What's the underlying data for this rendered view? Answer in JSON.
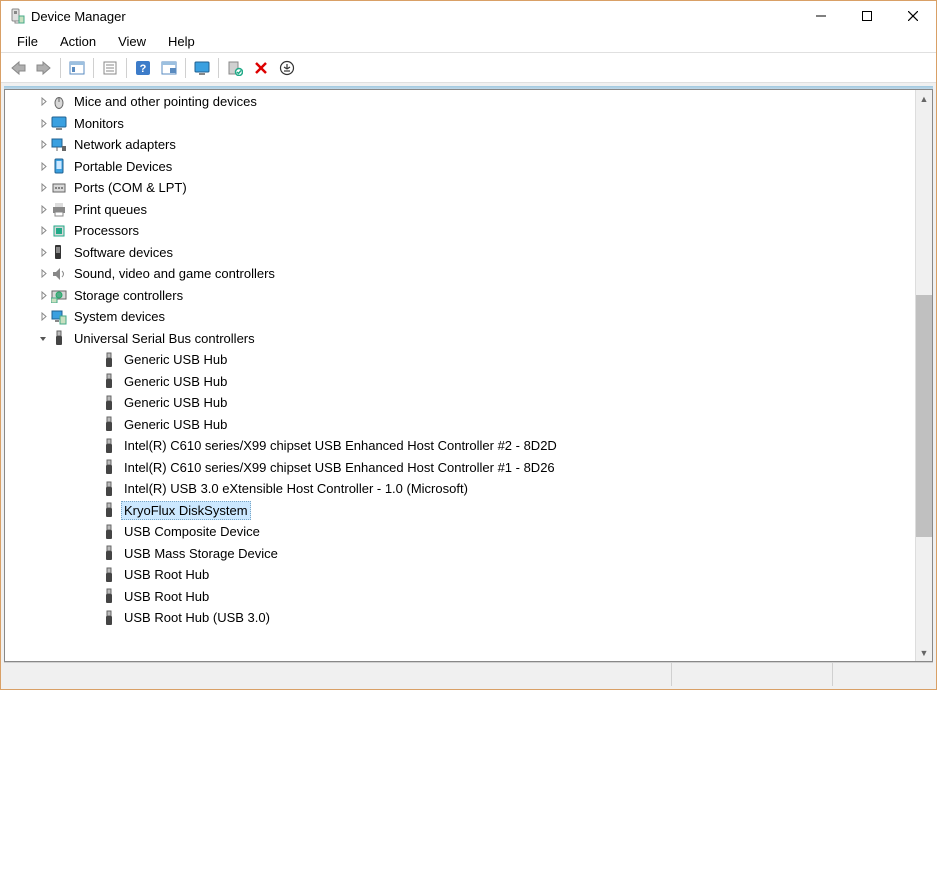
{
  "window": {
    "title": "Device Manager"
  },
  "menubar": {
    "items": [
      "File",
      "Action",
      "View",
      "Help"
    ]
  },
  "toolbar": {
    "back": "back-icon",
    "forward": "forward-icon",
    "show_hide": "show-hide-tree-icon",
    "properties": "properties-icon",
    "help": "help-icon",
    "action_icon": "action-icon",
    "show_monitor": "show-monitor-icon",
    "scan": "scan-hardware-icon",
    "delete": "delete-icon",
    "add_legacy": "add-legacy-icon"
  },
  "tree": {
    "categories": [
      {
        "label": "Mice and other pointing devices",
        "expanded": false,
        "icon": "mouse"
      },
      {
        "label": "Monitors",
        "expanded": false,
        "icon": "monitor"
      },
      {
        "label": "Network adapters",
        "expanded": false,
        "icon": "network"
      },
      {
        "label": "Portable Devices",
        "expanded": false,
        "icon": "portable"
      },
      {
        "label": "Ports (COM & LPT)",
        "expanded": false,
        "icon": "port"
      },
      {
        "label": "Print queues",
        "expanded": false,
        "icon": "printer"
      },
      {
        "label": "Processors",
        "expanded": false,
        "icon": "cpu"
      },
      {
        "label": "Software devices",
        "expanded": false,
        "icon": "software"
      },
      {
        "label": "Sound, video and game controllers",
        "expanded": false,
        "icon": "sound"
      },
      {
        "label": "Storage controllers",
        "expanded": false,
        "icon": "storage"
      },
      {
        "label": "System devices",
        "expanded": false,
        "icon": "system"
      },
      {
        "label": "Universal Serial Bus controllers",
        "expanded": true,
        "icon": "usb",
        "children": [
          {
            "label": "Generic USB Hub",
            "selected": false
          },
          {
            "label": "Generic USB Hub",
            "selected": false
          },
          {
            "label": "Generic USB Hub",
            "selected": false
          },
          {
            "label": "Generic USB Hub",
            "selected": false
          },
          {
            "label": "Intel(R) C610 series/X99 chipset USB Enhanced Host Controller #2 - 8D2D",
            "selected": false
          },
          {
            "label": "Intel(R) C610 series/X99 chipset USB Enhanced Host Controller #1 - 8D26",
            "selected": false
          },
          {
            "label": "Intel(R) USB 3.0 eXtensible Host Controller - 1.0 (Microsoft)",
            "selected": false
          },
          {
            "label": "KryoFlux DiskSystem",
            "selected": true
          },
          {
            "label": "USB Composite Device",
            "selected": false
          },
          {
            "label": "USB Mass Storage Device",
            "selected": false
          },
          {
            "label": "USB Root Hub",
            "selected": false
          },
          {
            "label": "USB Root Hub",
            "selected": false
          },
          {
            "label": "USB Root Hub (USB 3.0)",
            "selected": false
          }
        ]
      }
    ]
  }
}
